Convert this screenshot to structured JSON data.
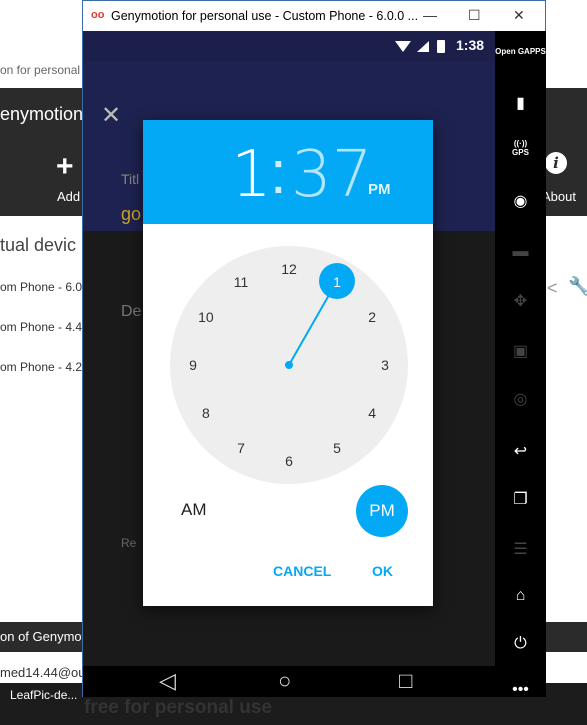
{
  "background": {
    "title_fragment": "on for personal u",
    "app_name": "enymotion",
    "add_label": "Add",
    "about_label": "About",
    "devices_header": "tual devic",
    "devices": [
      "om Phone - 6.0",
      "om Phone - 4.4",
      "om Phone - 4.2"
    ],
    "footer_text": "on of Genymot",
    "account_text": "med14.44@ou",
    "taskbar_item": "LeafPic-de..."
  },
  "window": {
    "title": "Genymotion for personal use - Custom Phone - 6.0.0 ...",
    "logo": "oo",
    "controls": [
      "—",
      "☐",
      "✕"
    ]
  },
  "status": {
    "time": "1:38"
  },
  "app": {
    "close": "✕",
    "title_label": "Titl",
    "title_value": "go",
    "description_label": "De",
    "reminder_label": "Re"
  },
  "picker": {
    "hour": "1",
    "minute": "37",
    "ampm_header": "PM",
    "hours": [
      "12",
      "1",
      "2",
      "3",
      "4",
      "5",
      "6",
      "7",
      "8",
      "9",
      "10",
      "11"
    ],
    "selected_hour": "1",
    "am_label": "AM",
    "pm_label": "PM",
    "cancel_label": "CANCEL",
    "ok_label": "OK"
  },
  "sidebar": {
    "open_gapps": "Open GAPPS",
    "gps": "GPS"
  },
  "watermark": "free for personal use",
  "colors": {
    "accent": "#03a9f4",
    "appbar": "#1e2250",
    "fab": "#c49a0b"
  }
}
